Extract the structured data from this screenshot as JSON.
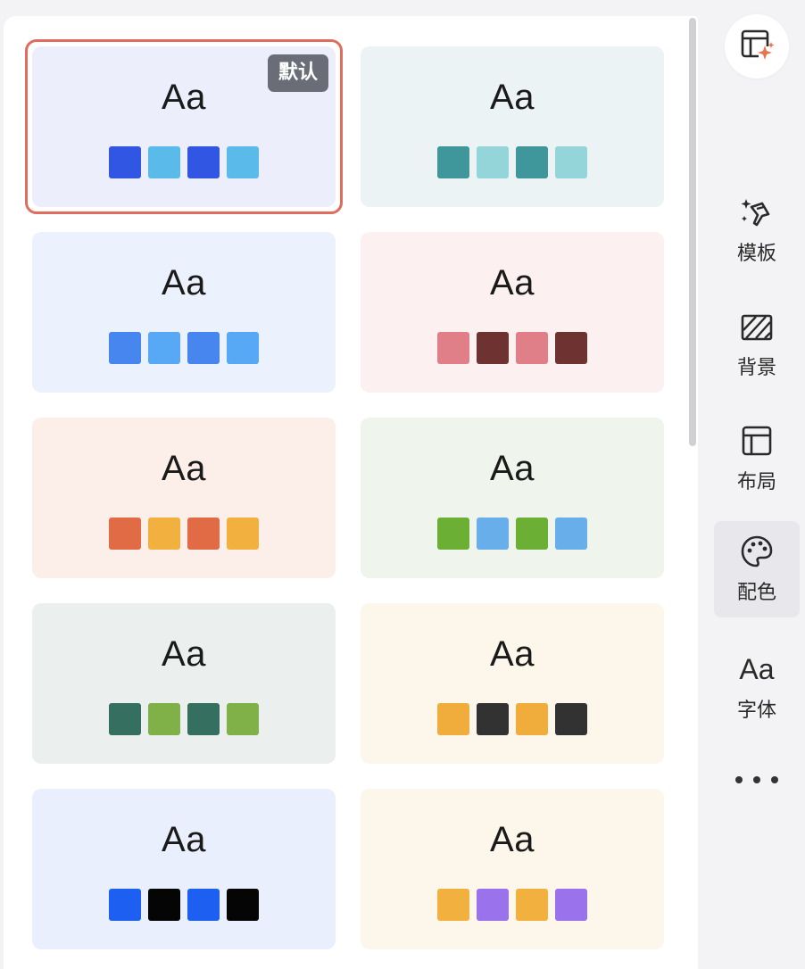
{
  "cards": [
    {
      "aa": "Aa",
      "bg": "#eceefc",
      "swatches": [
        "#3256e4",
        "#5abbea",
        "#3256e4",
        "#5abbea"
      ],
      "badge": "默认",
      "selected": true
    },
    {
      "aa": "Aa",
      "bg": "#ebf3f4",
      "swatches": [
        "#40979b",
        "#93d5d8",
        "#40979b",
        "#93d5d8"
      ]
    },
    {
      "aa": "Aa",
      "bg": "#ebf1fd",
      "swatches": [
        "#4785ef",
        "#57a9f6",
        "#4785ef",
        "#57a9f6"
      ]
    },
    {
      "aa": "Aa",
      "bg": "#fcf0f1",
      "swatches": [
        "#e07f88",
        "#6e3231",
        "#e07f88",
        "#6e3231"
      ]
    },
    {
      "aa": "Aa",
      "bg": "#fcefea",
      "swatches": [
        "#e16b44",
        "#f2b13f",
        "#e16b44",
        "#f2b13f"
      ]
    },
    {
      "aa": "Aa",
      "bg": "#eff5ec",
      "swatches": [
        "#6bb035",
        "#67aeea",
        "#6bb035",
        "#67aeea"
      ]
    },
    {
      "aa": "Aa",
      "bg": "#ebf0ef",
      "swatches": [
        "#356f5f",
        "#80b048",
        "#356f5f",
        "#80b048"
      ]
    },
    {
      "aa": "Aa",
      "bg": "#fdf6ea",
      "swatches": [
        "#f1ad3b",
        "#323232",
        "#f1ad3b",
        "#323232"
      ]
    },
    {
      "aa": "Aa",
      "bg": "#e9effd",
      "swatches": [
        "#1d5ff0",
        "#050505",
        "#1d5ff0",
        "#050505"
      ]
    },
    {
      "aa": "Aa",
      "bg": "#fdf6ea",
      "swatches": [
        "#f2b03e",
        "#9a72ec",
        "#f2b03e",
        "#9a72ec"
      ]
    }
  ],
  "sidebar": {
    "items": [
      {
        "label": "模板",
        "icon": "template-brush-icon",
        "active": false
      },
      {
        "label": "背景",
        "icon": "background-hatch-icon",
        "active": false
      },
      {
        "label": "布局",
        "icon": "layout-icon",
        "active": false
      },
      {
        "label": "配色",
        "icon": "palette-icon",
        "active": true
      },
      {
        "label": "字体",
        "icon": "font-aa-icon",
        "active": false,
        "glyph": "Aa"
      }
    ]
  },
  "colors": {
    "selected_border": "#e06c5e",
    "badge_bg": "#6a6c78",
    "ai_sparkle": "#e8734f"
  }
}
